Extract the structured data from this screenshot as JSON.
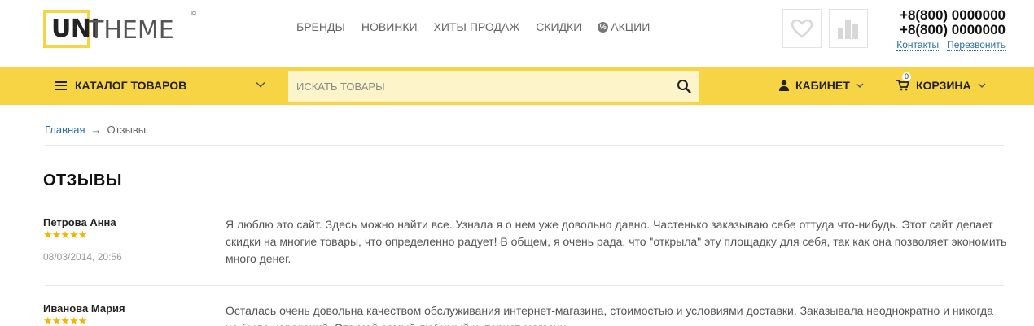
{
  "logo": {
    "uni": "UNI",
    "theme": "THEME",
    "copyright": "©"
  },
  "nav": [
    {
      "label": "БРЕНДЫ"
    },
    {
      "label": "НОВИНКИ"
    },
    {
      "label": "ХИТЫ ПРОДАЖ"
    },
    {
      "label": "СКИДКИ"
    },
    {
      "label": "АКЦИИ",
      "icon": "%"
    }
  ],
  "contacts": {
    "phone1": "+8(800) 0000000",
    "phone2": "+8(800) 0000000",
    "link_contacts": "Контакты",
    "link_callback": "Перезвонить"
  },
  "bar": {
    "catalog": "КАТАЛОГ ТОВАРОВ",
    "search_placeholder": "ИСКАТЬ ТОВАРЫ",
    "cabinet": "КАБИНЕТ",
    "cart": "КОРЗИНА",
    "cart_count": "0"
  },
  "breadcrumb": {
    "home": "Главная",
    "sep": "→",
    "current": "Отзывы"
  },
  "page_title": "ОТЗЫВЫ",
  "reviews": [
    {
      "author": "Петрова Анна",
      "rating": 5,
      "stars": "★★★★★",
      "date": "08/03/2014, 20:56",
      "text": "Я люблю это сайт. Здесь можно найти все. Узнала я о нем уже довольно давно. Частенько заказываю себе оттуда что-нибудь. Этот сайт делает скидки на многие товары, что определенно радует! В общем, я очень рада, что \"открыла\" эту площадку для себя, так как она позволяет экономить много денег."
    },
    {
      "author": "Иванова Мария",
      "rating": 5,
      "stars": "★★★★★",
      "date": "",
      "text": "Осталась очень довольна качеством обслуживания интернет-магазина, стоимостью и условиями доставки. Заказывала неоднократно и никогда не было нареканий. Это мой самый любимый интернет-магазин."
    }
  ],
  "colors": {
    "accent": "#f7d443",
    "search_bg": "#fef4c9",
    "link": "#2a6ea6",
    "stars": "#f4b400"
  }
}
